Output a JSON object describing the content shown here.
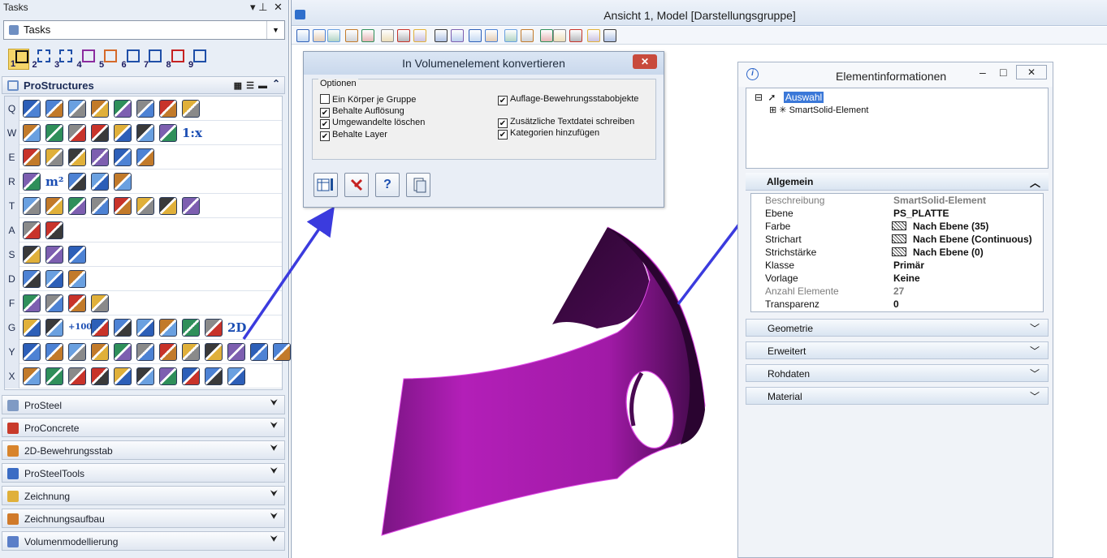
{
  "tasks": {
    "title": "Tasks",
    "pin_glyph": "▾ ⊥",
    "close_glyph": "✕",
    "combo_value": "Tasks",
    "steps": [
      "1",
      "2",
      "3",
      "4",
      "5",
      "6",
      "7",
      "8",
      "9"
    ],
    "section_title": "ProStructures",
    "rows": [
      {
        "letter": "Q"
      },
      {
        "letter": "W"
      },
      {
        "letter": "E"
      },
      {
        "letter": "R"
      },
      {
        "letter": "T"
      },
      {
        "letter": "A"
      },
      {
        "letter": "S"
      },
      {
        "letter": "D"
      },
      {
        "letter": "F"
      },
      {
        "letter": "G"
      },
      {
        "letter": "Y"
      },
      {
        "letter": "X"
      }
    ],
    "text_tools": {
      "scale": "1:x",
      "m2": "m²",
      "plus100": "+100",
      "two_d": "2D"
    },
    "categories": [
      {
        "label": "ProSteel",
        "color": "#7f9ac4"
      },
      {
        "label": "ProConcrete",
        "color": "#c83a2a"
      },
      {
        "label": "2D-Bewehrungsstab",
        "color": "#d8842c"
      },
      {
        "label": "ProSteelTools",
        "color": "#3b6cc4"
      },
      {
        "label": "Zeichnung",
        "color": "#e0b03a"
      },
      {
        "label": "Zeichnungsaufbau",
        "color": "#d07a2a"
      },
      {
        "label": "Volumenmodellierung",
        "color": "#5a7ec8"
      }
    ]
  },
  "view": {
    "title": "Ansicht 1, Model [Darstellungsgruppe]"
  },
  "dialog": {
    "title": "In Volumenelement konvertieren",
    "close_glyph": "✕",
    "group_label": "Optionen",
    "options_left": [
      {
        "label": "Ein Körper je Gruppe",
        "checked": false
      },
      {
        "label": "Behalte Auflösung",
        "checked": true
      },
      {
        "label": "Umgewandelte löschen",
        "checked": true
      },
      {
        "label": "Behalte Layer",
        "checked": true
      }
    ],
    "options_right": [
      {
        "label": "Auflage-Bewehrungsstabobjekte",
        "checked": true
      },
      {
        "label": "Zusätzliche Textdatei schreiben",
        "checked": true
      },
      {
        "label": "Kategorien hinzufügen",
        "checked": true
      }
    ],
    "buttons": {
      "help": "?"
    }
  },
  "info": {
    "title": "Elementinformationen",
    "info_glyph": "i",
    "minimize_glyph": "–",
    "maximize_glyph": "□",
    "close_glyph": "✕",
    "tree_root": "Auswahl",
    "tree_child": "SmartSolid-Element",
    "tree_expand_glyph": "⊟",
    "tree_child_expand_glyph": "⊞",
    "section_general": "Allgemein",
    "properties": [
      {
        "key": "Beschreibung",
        "value": "SmartSolid-Element",
        "dim": true,
        "swatch": false
      },
      {
        "key": "Ebene",
        "value": "PS_PLATTE",
        "dim": false,
        "swatch": false
      },
      {
        "key": "Farbe",
        "value": "Nach Ebene (35)",
        "dim": false,
        "swatch": true
      },
      {
        "key": "Strichart",
        "value": "Nach Ebene (Continuous)",
        "dim": false,
        "swatch": true
      },
      {
        "key": "Strichstärke",
        "value": "Nach Ebene (0)",
        "dim": false,
        "swatch": true
      },
      {
        "key": "Klasse",
        "value": "Primär",
        "dim": false,
        "swatch": false
      },
      {
        "key": "Vorlage",
        "value": "Keine",
        "dim": false,
        "swatch": false
      },
      {
        "key": "Anzahl Elemente",
        "value": "27",
        "dim": true,
        "swatch": false
      },
      {
        "key": "Transparenz",
        "value": "0",
        "dim": false,
        "swatch": false
      }
    ],
    "sections": [
      "Geometrie",
      "Erweitert",
      "Rohdaten",
      "Material"
    ]
  },
  "colors": {
    "solid_light": "#b31fb8",
    "solid_dark": "#2b0530",
    "arrow": "#3b3bde",
    "selection": "#3b78d8"
  }
}
